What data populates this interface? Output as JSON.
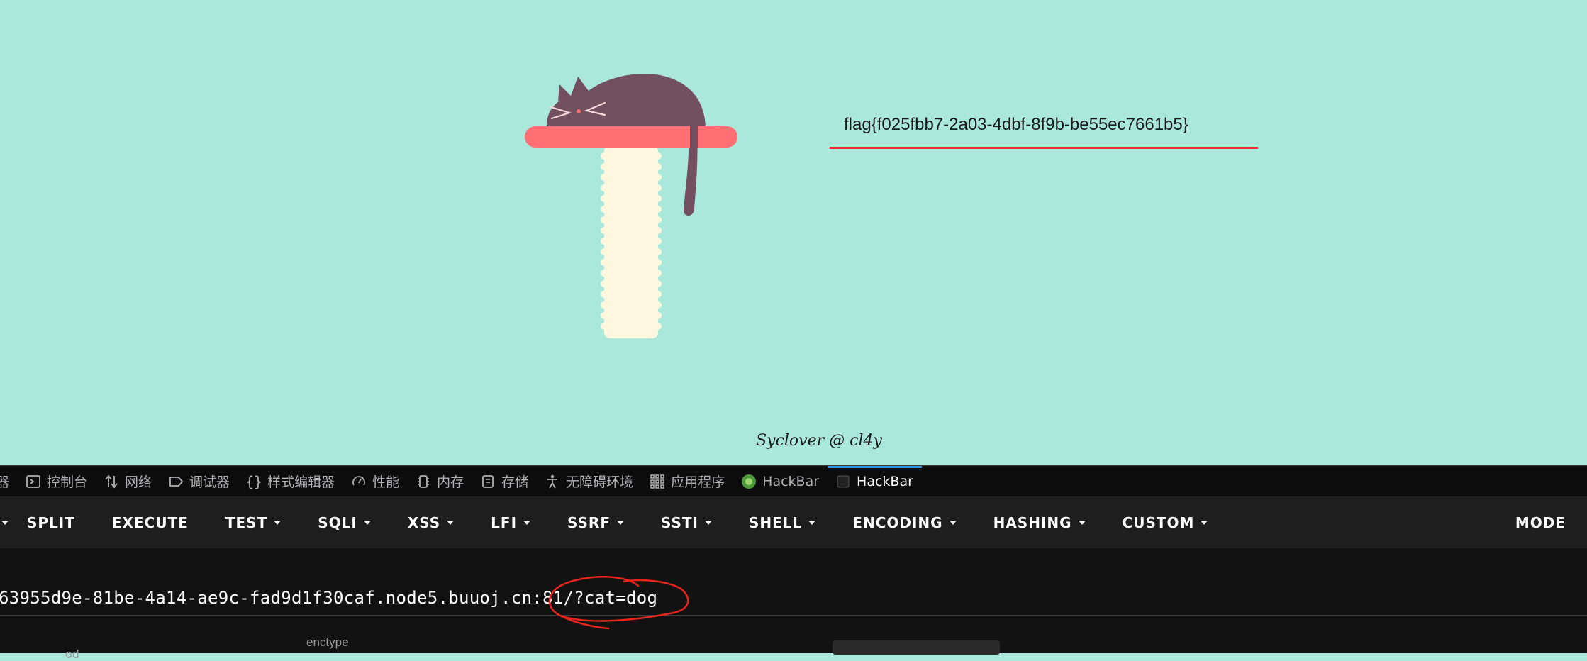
{
  "page": {
    "flag": "flag{f025fbb7-2a03-4dbf-8f9b-be55ec7661b5}",
    "footer": "Syclover @ cl4y"
  },
  "devtools": {
    "tabs": [
      {
        "label": "器",
        "icon": "inspector-icon"
      },
      {
        "label": "控制台",
        "icon": "console-icon"
      },
      {
        "label": "网络",
        "icon": "network-icon"
      },
      {
        "label": "调试器",
        "icon": "debugger-icon"
      },
      {
        "label": "样式编辑器",
        "icon": "style-editor-icon"
      },
      {
        "label": "性能",
        "icon": "performance-icon"
      },
      {
        "label": "内存",
        "icon": "memory-icon"
      },
      {
        "label": "存储",
        "icon": "storage-icon"
      },
      {
        "label": "无障碍环境",
        "icon": "accessibility-icon"
      },
      {
        "label": "应用程序",
        "icon": "application-icon"
      },
      {
        "label": "HackBar",
        "icon": "hackbar-green-icon"
      },
      {
        "label": "HackBar",
        "icon": "hackbar-icon",
        "active": true
      }
    ]
  },
  "hackbar": {
    "menu": {
      "split": "SPLIT",
      "execute": "EXECUTE",
      "test": "TEST",
      "sqli": "SQLI",
      "xss": "XSS",
      "lfi": "LFI",
      "ssrf": "SSRF",
      "ssti": "SSTI",
      "shell": "SHELL",
      "encoding": "ENCODING",
      "hashing": "HASHING",
      "custom": "CUSTOM",
      "mode": "MODE"
    },
    "url": "63955d9e-81be-4a14-ae9c-fad9d1f30caf.node5.buuoj.cn:81/?cat=dog",
    "enctype_label": "enctype",
    "partial_label": "od"
  },
  "colors": {
    "page_bg": "#aae8dc",
    "flag_underline": "#e8312a",
    "cat": "#735060",
    "shelf": "#ff6f74",
    "post": "#fdf7df",
    "annotation": "#e8241c",
    "active_tab": "#2a90e0"
  }
}
